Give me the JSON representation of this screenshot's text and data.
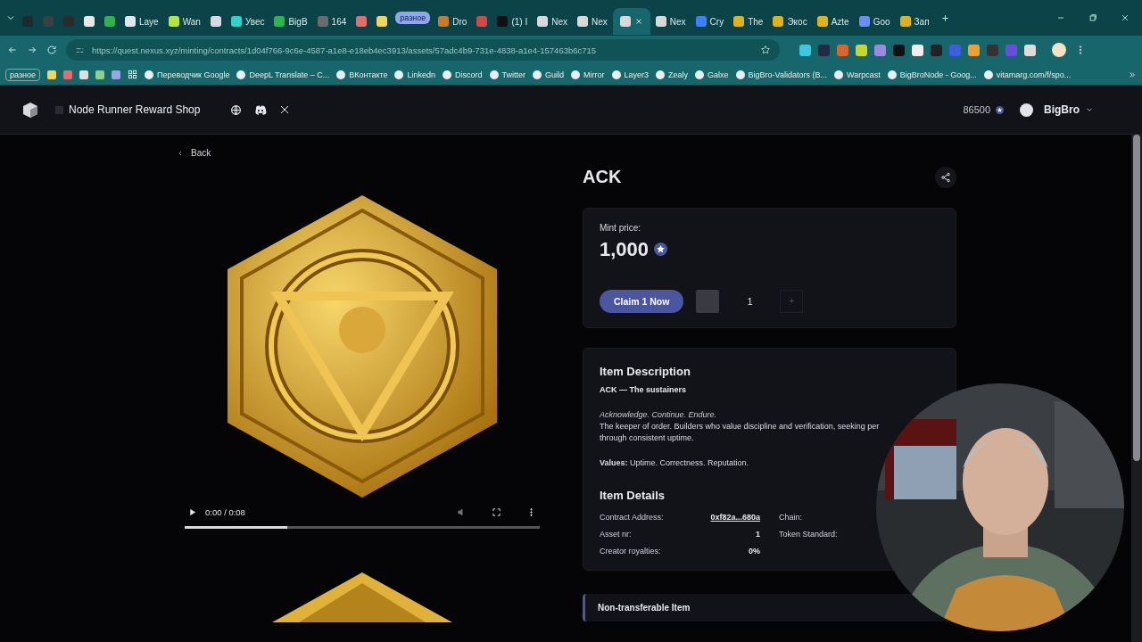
{
  "browser": {
    "tabs": [
      {
        "kind": "tab",
        "color": "#1e2a2e",
        "selected": false
      },
      {
        "kind": "tab",
        "color": "#3a3f44",
        "selected": false
      },
      {
        "kind": "tab",
        "color": "#2b2b2b",
        "selected": false
      },
      {
        "kind": "tab",
        "color": "#e8e8e8",
        "selected": false
      },
      {
        "kind": "tab",
        "color": "#2fb34a",
        "selected": false
      },
      {
        "kind": "tab",
        "title": "Laye",
        "color": "#dfe8f0",
        "selected": false
      },
      {
        "kind": "tab",
        "title": "Wan",
        "color": "#b7e63b",
        "selected": false
      },
      {
        "kind": "tab",
        "color": "#d9d9e3",
        "selected": false
      },
      {
        "kind": "tab",
        "title": "Увес",
        "color": "#2fd3c8",
        "selected": false
      },
      {
        "kind": "tab",
        "title": "BigB",
        "color": "#2fb34a",
        "selected": false
      },
      {
        "kind": "tab",
        "title": "164",
        "color": "#6b6b6b",
        "selected": false
      },
      {
        "kind": "tab",
        "color": "#e36c6c",
        "selected": false
      },
      {
        "kind": "tab",
        "color": "#f2d65c",
        "selected": false
      },
      {
        "kind": "group",
        "title": "разное",
        "selected": false
      },
      {
        "kind": "tab",
        "title": "Dro",
        "color": "#c87a2a",
        "selected": false
      },
      {
        "kind": "tab",
        "color": "#d04a4a",
        "selected": false
      },
      {
        "kind": "tab",
        "title": "(1) I",
        "color": "#111111",
        "selected": false
      },
      {
        "kind": "tab",
        "title": "Nex",
        "color": "#d9d9d9",
        "selected": false
      },
      {
        "kind": "tab",
        "title": "Nex",
        "color": "#d9d9d9",
        "selected": false
      },
      {
        "kind": "tab",
        "color": "#d9d9d9",
        "selected": true
      },
      {
        "kind": "tab",
        "title": "Nex",
        "color": "#d9d9d9",
        "selected": false
      },
      {
        "kind": "tab",
        "title": "Cry",
        "color": "#3b82f6",
        "selected": false
      },
      {
        "kind": "tab",
        "title": "The",
        "color": "#e0b21a",
        "selected": false
      },
      {
        "kind": "tab",
        "title": "Экос",
        "color": "#e0b21a",
        "selected": false
      },
      {
        "kind": "tab",
        "title": "Azte",
        "color": "#e0b21a",
        "selected": false
      },
      {
        "kind": "tab",
        "title": "Goo",
        "color": "#6c8ef2",
        "selected": false
      },
      {
        "kind": "tab",
        "title": "Зап",
        "color": "#e0b21a",
        "selected": false
      }
    ],
    "address": "https://quest.nexus.xyz/minting/contracts/1d04f766-9c6e-4587-a1e8-e18eb4ec3913/assets/57adc4b9-731e-4838-a1e4-157463b6c715",
    "bookmarks": [
      {
        "kind": "chip",
        "title": "разное"
      },
      {
        "kind": "folder",
        "color": "#f2d65c"
      },
      {
        "kind": "folder",
        "color": "#e36c6c"
      },
      {
        "kind": "folder",
        "color": "#e0e0e0"
      },
      {
        "kind": "folder",
        "color": "#8fd18a"
      },
      {
        "kind": "folder",
        "color": "#9aa6e8"
      },
      {
        "kind": "apps"
      },
      {
        "kind": "link",
        "title": "Переводчик Google"
      },
      {
        "kind": "link",
        "title": "DeepL Translate – C..."
      },
      {
        "kind": "link",
        "title": "ВКонтакте"
      },
      {
        "kind": "link",
        "title": "Linkedn"
      },
      {
        "kind": "link",
        "title": "Discord"
      },
      {
        "kind": "link",
        "title": "Twitter"
      },
      {
        "kind": "link",
        "title": "Guild"
      },
      {
        "kind": "link",
        "title": "Mirror"
      },
      {
        "kind": "link",
        "title": "Layer3"
      },
      {
        "kind": "link",
        "title": "Zealy"
      },
      {
        "kind": "link",
        "title": "Galxe"
      },
      {
        "kind": "link",
        "title": "BigBro-Validators (B..."
      },
      {
        "kind": "link",
        "title": "Warpcast"
      },
      {
        "kind": "link",
        "title": "BigBroNode - Goog..."
      },
      {
        "kind": "link",
        "title": "vitamarg.com/f/spo..."
      }
    ]
  },
  "header": {
    "shop_name": "Node Runner Reward Shop",
    "balance": "86500",
    "user": "BigBro"
  },
  "back": "Back",
  "media": {
    "time": "0:00 / 0:08",
    "level": 0.29
  },
  "item": {
    "title": "ACK",
    "mint_label": "Mint price:",
    "price": "1,000",
    "claim_button": "Claim 1 Now",
    "quantity": "1",
    "increment": "+"
  },
  "description": {
    "heading": "Item Description",
    "subtitle": "ACK — The sustainers",
    "motto": "Acknowledge. Continue. Endure.",
    "lines": [
      "The keeper of order. Builders who value discipline and verification, seeking per",
      "through consistent uptime."
    ],
    "values": "**Values:** Uptime. Correctness. Reputation."
  },
  "details": {
    "heading": "Item Details",
    "rows": [
      {
        "label": "Contract Address:",
        "value": "0xf82a...680a",
        "kind": "link"
      },
      {
        "label": "Asset nr:",
        "value": "1",
        "kind": "plain"
      },
      {
        "label": "Creator royalties:",
        "value": "0%",
        "kind": "plain"
      }
    ],
    "side_labels": [
      "Chain:",
      "Token Standard:"
    ]
  },
  "notice": {
    "title": "Non-transferable Item"
  }
}
